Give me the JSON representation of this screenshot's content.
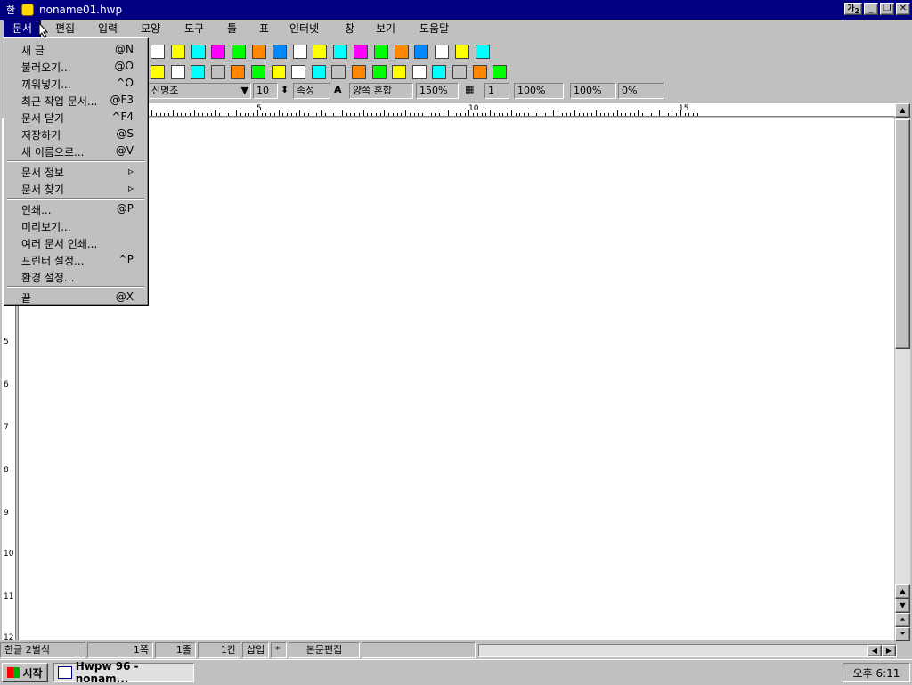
{
  "window": {
    "title": "noname01.hwp",
    "ime_label": "가",
    "ime_sub": "2"
  },
  "menubar": [
    "문서",
    "편집",
    "입력",
    "모양",
    "도구",
    "틀",
    "표",
    "인터넷",
    "창",
    "보기",
    "도움말"
  ],
  "file_menu": [
    {
      "label": "새 글",
      "shortcut": "@N"
    },
    {
      "label": "불러오기...",
      "shortcut": "@O"
    },
    {
      "label": "끼워넣기...",
      "shortcut": "^O"
    },
    {
      "label": "최근 작업 문서...",
      "shortcut": "@F3"
    },
    {
      "label": "문서 닫기",
      "shortcut": "^F4"
    },
    {
      "label": "저장하기",
      "shortcut": "@S"
    },
    {
      "label": "새 이름으로...",
      "shortcut": "@V"
    },
    {
      "label": "문서 정보",
      "shortcut": "▹"
    },
    {
      "label": "문서 찾기",
      "shortcut": "▹"
    },
    {
      "label": "인쇄...",
      "shortcut": "@P"
    },
    {
      "label": "미리보기...",
      "shortcut": ""
    },
    {
      "label": "여러 문서 인쇄...",
      "shortcut": ""
    },
    {
      "label": "프린터 설정...",
      "shortcut": "^P"
    },
    {
      "label": "환경 설정...",
      "shortcut": ""
    },
    {
      "label": "끝",
      "shortcut": "@X"
    }
  ],
  "format_bar": {
    "font": "신명조",
    "size": "10",
    "attr": "속성",
    "char_icon": "A",
    "align": "양쪽 혼합",
    "line_spacing": "150%",
    "columns": "1",
    "width_pct": "100%",
    "height_pct": "100%",
    "spacing_pct": "0%"
  },
  "ruler": {
    "top_labels": [
      "5",
      "10",
      "15"
    ],
    "side_labels": [
      "5",
      "6",
      "7",
      "8",
      "9",
      "10",
      "11",
      "12"
    ]
  },
  "statusbar": [
    "한글 2벌식",
    "1쪽",
    "1줄",
    "1칸",
    "삽입",
    "*",
    "본문편집"
  ],
  "taskbar": {
    "start": "시작",
    "task": "Hwpw 96 - nonam...",
    "clock": "오후 6:11"
  }
}
